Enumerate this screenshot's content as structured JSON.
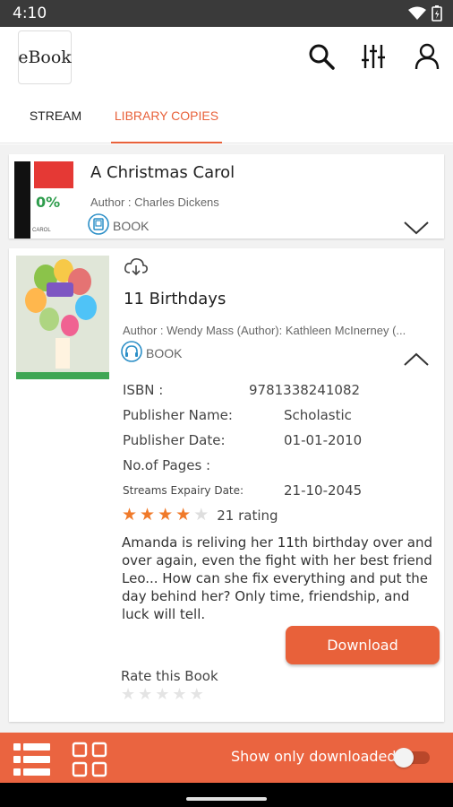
{
  "status_bar": {
    "time": "4:10",
    "icons": [
      "wifi-icon",
      "battery-icon"
    ]
  },
  "app_bar": {
    "logo_text": "eBook",
    "actions": [
      "search-icon",
      "filter-sliders-icon",
      "account-icon"
    ]
  },
  "tabs": [
    {
      "label": "STREAM",
      "active": false
    },
    {
      "label": "LIBRARY COPIES",
      "active": true
    }
  ],
  "colors": {
    "accent": "#e8613a",
    "progress_green": "#2e9c4c",
    "star": "#f07a2a"
  },
  "books": [
    {
      "title": "A Christmas Carol",
      "author": "Author : Charles Dickens",
      "progress": "0%",
      "type": "BOOK",
      "type_icon": "ebook-icon",
      "expanded": false
    },
    {
      "title": "11 Birthdays",
      "author": "Author : Wendy Mass (Author):  Kathleen McInerney (...",
      "type": "BOOK",
      "type_icon": "audiobook-headphones-icon",
      "expanded": true,
      "details": {
        "isbn_label": "ISBN :",
        "isbn": "9781338241082",
        "publisher_label": "Publisher Name:",
        "publisher": "Scholastic",
        "publish_date_label": "Publisher Date:",
        "publish_date": "01-01-2010",
        "pages_label": "No.of Pages :",
        "pages": "",
        "expiry_label": "Streams Expairy Date:",
        "expiry": "21-10-2045"
      },
      "rating_stars": 4,
      "rating_max": 5,
      "rating_text": "21 rating",
      "description": "Amanda is reliving her 11th birthday over and over again, even the fight with her best friend Leo... How can she fix everything and put the day behind her? Only time, friendship, and luck will tell.",
      "download_label": "Download",
      "rate_label": "Rate this Book",
      "user_rating": 0
    }
  ],
  "bottom_bar": {
    "show_downloaded_label": "Show only downloaded",
    "show_downloaded": false,
    "view_icons": [
      "list-view-icon",
      "grid-view-icon"
    ]
  }
}
